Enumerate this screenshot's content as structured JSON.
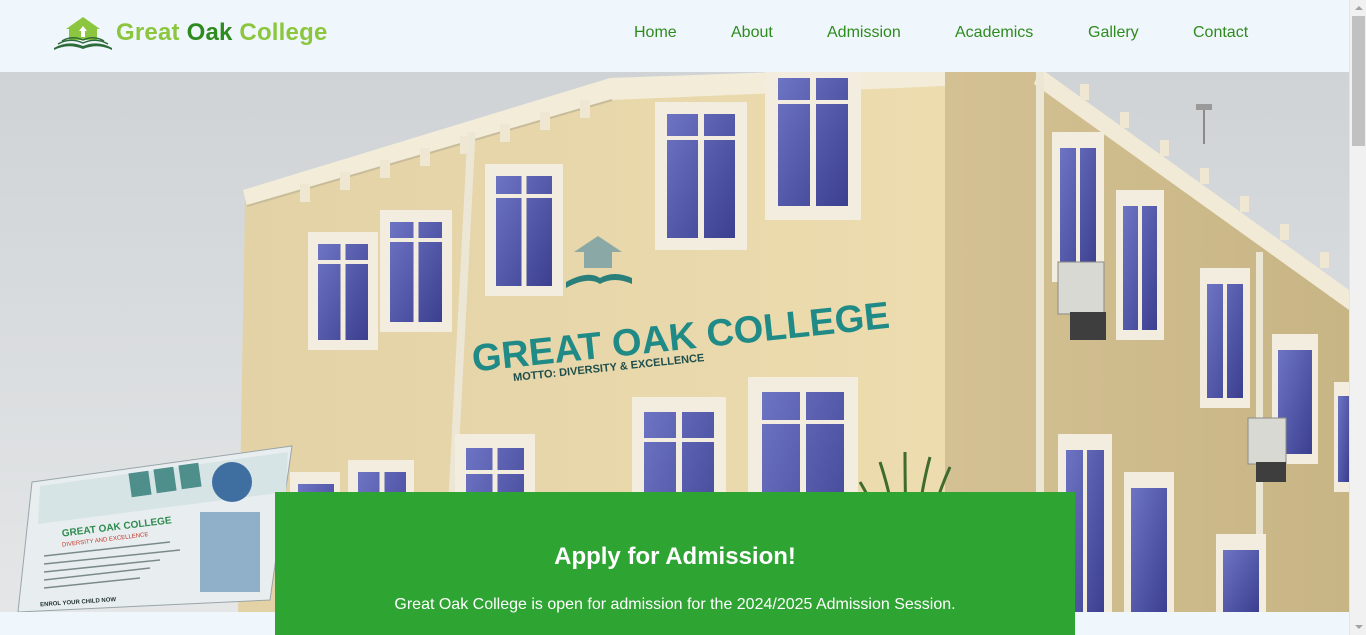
{
  "brand": {
    "name_part1": "Great ",
    "name_part2": "Oak",
    "name_part3": " College",
    "logo_icon": "graduation-cap-book-logo"
  },
  "nav": {
    "items": [
      {
        "label": "Home"
      },
      {
        "label": "About"
      },
      {
        "label": "Admission"
      },
      {
        "label": "Academics"
      },
      {
        "label": "Gallery"
      },
      {
        "label": "Contact"
      }
    ]
  },
  "hero": {
    "sign_main": "GREAT OAK COLLEGE",
    "sign_motto": "MOTTO: DIVERSITY & EXCELLENCE",
    "billboard_title": "GREAT OAK COLLEGE",
    "billboard_sub": "DIVERSITY AND EXCELLENCE",
    "billboard_footer": "ENROL YOUR CHILD NOW"
  },
  "admission": {
    "title": "Apply for Admission!",
    "text": "Great Oak College is open for admission for the 2024/2025 Admission Session."
  },
  "colors": {
    "brand_light": "#8cc63f",
    "brand_dark": "#2e8b1e",
    "nav_text": "#2e8b1e",
    "card_bg": "#2ea433",
    "header_bg": "#f0f7fc"
  }
}
